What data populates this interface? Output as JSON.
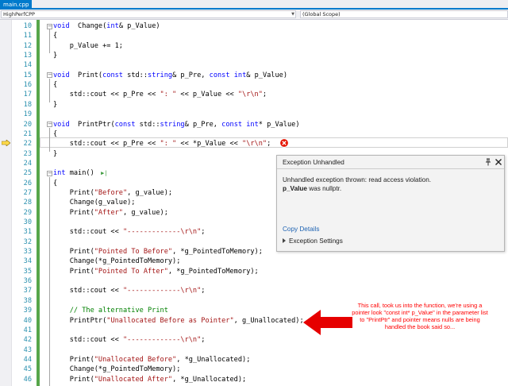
{
  "tab": {
    "file": "main.cpp"
  },
  "nav": {
    "project": "HighPerfCPP",
    "scope": "(Global Scope)"
  },
  "lines": [
    {
      "n": "10",
      "code": [
        [
          "kw",
          "void"
        ],
        [
          "",
          "  Change("
        ],
        [
          "kw",
          "int"
        ],
        [
          "",
          "& p_Value)"
        ]
      ]
    },
    {
      "n": "11",
      "code": [
        [
          "",
          "{"
        ]
      ]
    },
    {
      "n": "12",
      "code": [
        [
          "",
          "    p_Value += 1;"
        ]
      ]
    },
    {
      "n": "13",
      "code": [
        [
          "",
          "}"
        ]
      ]
    },
    {
      "n": "14",
      "code": []
    },
    {
      "n": "15",
      "code": [
        [
          "kw",
          "void"
        ],
        [
          "",
          "  Print("
        ],
        [
          "kw",
          "const"
        ],
        [
          "",
          " std::"
        ],
        [
          "kw",
          "string"
        ],
        [
          "",
          "& p_Pre, "
        ],
        [
          "kw",
          "const"
        ],
        [
          "",
          " "
        ],
        [
          "kw",
          "int"
        ],
        [
          "",
          "& p_Value)"
        ]
      ]
    },
    {
      "n": "16",
      "code": [
        [
          "",
          "{"
        ]
      ]
    },
    {
      "n": "17",
      "code": [
        [
          "",
          "    std::cout << p_Pre << "
        ],
        [
          "str",
          "\": \""
        ],
        [
          "",
          " << p_Value << "
        ],
        [
          "str",
          "\"\\r\\n\""
        ],
        [
          "",
          ";"
        ]
      ]
    },
    {
      "n": "18",
      "code": [
        [
          "",
          "}"
        ]
      ]
    },
    {
      "n": "19",
      "code": []
    },
    {
      "n": "20",
      "code": [
        [
          "kw",
          "void"
        ],
        [
          "",
          "  PrintPtr("
        ],
        [
          "kw",
          "const"
        ],
        [
          "",
          " std::"
        ],
        [
          "kw",
          "string"
        ],
        [
          "",
          "& p_Pre, "
        ],
        [
          "kw",
          "const"
        ],
        [
          "",
          " "
        ],
        [
          "kw",
          "int"
        ],
        [
          "",
          "* p_Value)"
        ]
      ]
    },
    {
      "n": "21",
      "code": [
        [
          "",
          "{"
        ]
      ]
    },
    {
      "n": "22",
      "code": [
        [
          "",
          "    std::cout << p_Pre << "
        ],
        [
          "str",
          "\": \""
        ],
        [
          "",
          " << *p_Value << "
        ],
        [
          "str",
          "\"\\r\\n\""
        ],
        [
          "",
          ";"
        ]
      ]
    },
    {
      "n": "23",
      "code": [
        [
          "",
          "}"
        ]
      ]
    },
    {
      "n": "24",
      "code": []
    },
    {
      "n": "25",
      "code": [
        [
          "kw",
          "int"
        ],
        [
          "",
          " main()"
        ]
      ]
    },
    {
      "n": "26",
      "code": [
        [
          "",
          "{"
        ]
      ]
    },
    {
      "n": "27",
      "code": [
        [
          "",
          "    Print("
        ],
        [
          "str",
          "\"Before\""
        ],
        [
          "",
          ", g_value);"
        ]
      ]
    },
    {
      "n": "28",
      "code": [
        [
          "",
          "    Change(g_value);"
        ]
      ]
    },
    {
      "n": "29",
      "code": [
        [
          "",
          "    Print("
        ],
        [
          "str",
          "\"After\""
        ],
        [
          "",
          ", g_value);"
        ]
      ]
    },
    {
      "n": "30",
      "code": []
    },
    {
      "n": "31",
      "code": [
        [
          "",
          "    std::cout << "
        ],
        [
          "str",
          "\"-------------\\r\\n\""
        ],
        [
          "",
          ";"
        ]
      ]
    },
    {
      "n": "32",
      "code": []
    },
    {
      "n": "33",
      "code": [
        [
          "",
          "    Print("
        ],
        [
          "str",
          "\"Pointed To Before\""
        ],
        [
          "",
          ", *g_PointedToMemory);"
        ]
      ]
    },
    {
      "n": "34",
      "code": [
        [
          "",
          "    Change(*g_PointedToMemory);"
        ]
      ]
    },
    {
      "n": "35",
      "code": [
        [
          "",
          "    Print("
        ],
        [
          "str",
          "\"Pointed To After\""
        ],
        [
          "",
          ", *g_PointedToMemory);"
        ]
      ]
    },
    {
      "n": "36",
      "code": []
    },
    {
      "n": "37",
      "code": [
        [
          "",
          "    std::cout << "
        ],
        [
          "str",
          "\"-------------\\r\\n\""
        ],
        [
          "",
          ";"
        ]
      ]
    },
    {
      "n": "38",
      "code": []
    },
    {
      "n": "39",
      "code": [
        [
          "cmt",
          "    // The alternative Print"
        ]
      ]
    },
    {
      "n": "40",
      "code": [
        [
          "",
          "    PrintPtr("
        ],
        [
          "str",
          "\"Unallocated Before as Pointer\""
        ],
        [
          "",
          ", g_Unallocated);"
        ]
      ]
    },
    {
      "n": "41",
      "code": []
    },
    {
      "n": "42",
      "code": [
        [
          "",
          "    std::cout << "
        ],
        [
          "str",
          "\"-------------\\r\\n\""
        ],
        [
          "",
          ";"
        ]
      ]
    },
    {
      "n": "43",
      "code": []
    },
    {
      "n": "44",
      "code": [
        [
          "",
          "    Print("
        ],
        [
          "str",
          "\"Unallocated Before\""
        ],
        [
          "",
          ", *g_Unallocated);"
        ]
      ]
    },
    {
      "n": "45",
      "code": [
        [
          "",
          "    Change(*g_PointedToMemory);"
        ]
      ]
    },
    {
      "n": "46",
      "code": [
        [
          "",
          "    Print("
        ],
        [
          "str",
          "\"Unallocated After\""
        ],
        [
          "",
          ", *g_Unallocated);"
        ]
      ]
    }
  ],
  "popup": {
    "title": "Exception Unhandled",
    "message": "Unhandled exception thrown: read access violation.",
    "detail_bold": "p_Value",
    "detail_rest": " was nullptr.",
    "copy_details": "Copy Details",
    "settings": "Exception Settings"
  },
  "annotation": {
    "text": "This call, took us into the function, we're using a pointer look \"const int* p_Value\" in the parameter list to \"PrintPtr\" and pointer means nulls are being handled the book said so..."
  },
  "colors": {
    "keyword": "#0000ff",
    "string": "#a31515",
    "comment": "#008000",
    "line_number": "#2b91af",
    "annotation": "#ff0000",
    "tab_accent": "#007acc"
  }
}
